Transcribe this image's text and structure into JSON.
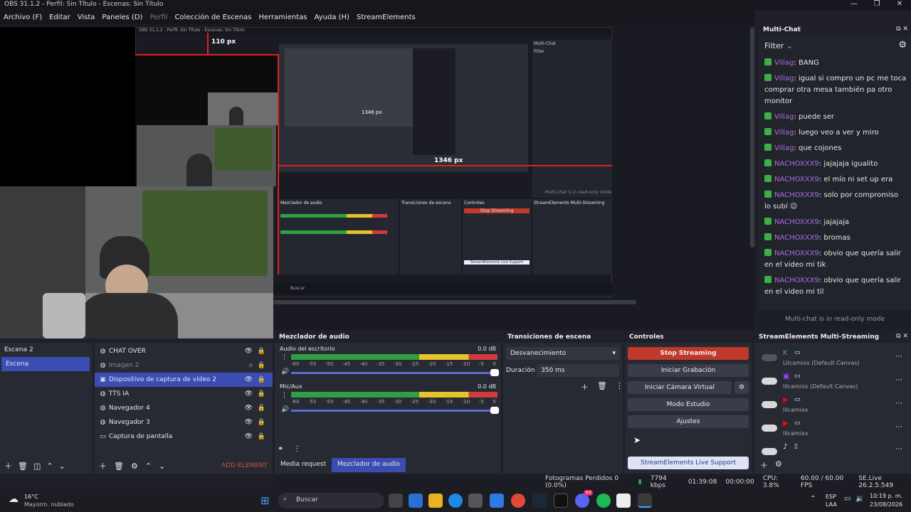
{
  "window": {
    "title": "OBS 31.1.2 - Perfil: Sin Título - Escenas: Sin Título",
    "controls": [
      "—",
      "❐",
      "✕"
    ]
  },
  "menu": [
    {
      "label": "Archivo (F)",
      "enabled": true
    },
    {
      "label": "Editar",
      "enabled": true
    },
    {
      "label": "Vista",
      "enabled": true
    },
    {
      "label": "Paneles (D)",
      "enabled": true
    },
    {
      "label": "Perfil",
      "enabled": false
    },
    {
      "label": "Colección de Escenas",
      "enabled": true
    },
    {
      "label": "Herramientas",
      "enabled": true
    },
    {
      "label": "Ayuda (H)",
      "enabled": true
    },
    {
      "label": "StreamElements",
      "enabled": true
    }
  ],
  "preview": {
    "nested_title": "OBS 31.1.2 - Perfil: Sin Título - Escenas: Sin Título",
    "measure_top": "110 px",
    "measure_right": "1346 px",
    "measure_inner": "1346 px",
    "inner_multichat": "Multi-Chat",
    "inner_filter": "Filter",
    "inner_readonly": "Multi-chat is in read-only mode",
    "inner_audio": "Mezclador de audio",
    "inner_transitions": "Transiciones de escena",
    "inner_controls": "Controles",
    "inner_se": "StreamElements Multi-Streaming",
    "inner_stop": "Stop Streaming",
    "inner_support": "StreamElements Live Support",
    "inner_search": "Buscar"
  },
  "scenes": {
    "items": [
      {
        "label": "Escena 2",
        "selected": false
      },
      {
        "label": "Escena",
        "selected": true
      }
    ]
  },
  "sources": {
    "items": [
      {
        "label": "CHAT OVER",
        "visible": true,
        "selected": false,
        "icon": "globe-icon"
      },
      {
        "label": "Imagen 2",
        "visible": false,
        "selected": false,
        "icon": "image-icon"
      },
      {
        "label": "Dispositivo de captura de vídeo 2",
        "visible": true,
        "selected": true,
        "icon": "camera-icon"
      },
      {
        "label": "TTS IA",
        "visible": true,
        "selected": false,
        "icon": "globe-icon"
      },
      {
        "label": "Navegador 4",
        "visible": true,
        "selected": false,
        "icon": "globe-icon"
      },
      {
        "label": "Navegador 3",
        "visible": true,
        "selected": false,
        "icon": "globe-icon"
      },
      {
        "label": "Captura de pantalla",
        "visible": true,
        "selected": false,
        "icon": "monitor-icon"
      }
    ],
    "add_element": "ADD ELEMENT"
  },
  "audio": {
    "title": "Mezclador de audio",
    "channels": [
      {
        "name": "Audio del escritorio",
        "db": "0.0 dB",
        "level": 0.85
      },
      {
        "name": "Mic/Aux",
        "db": "0.0 dB",
        "level": 0.95
      }
    ],
    "scale": [
      "-60",
      "-55",
      "-50",
      "-45",
      "-40",
      "-35",
      "-30",
      "-25",
      "-20",
      "-15",
      "-10",
      "-5",
      "0"
    ],
    "tabs": [
      "Media request",
      "Mezclador de audio"
    ]
  },
  "transitions": {
    "title": "Transiciones de escena",
    "selected": "Desvanecimiento",
    "duration_label": "Duración",
    "duration_value": "350 ms"
  },
  "controls": {
    "title": "Controles",
    "stop": "Stop Streaming",
    "record": "Iniciar Grabación",
    "virtualcam": "Iniciar Cámara Virtual",
    "studio": "Modo Estudio",
    "settings": "Ajustes",
    "support": "StreamElements Live Support"
  },
  "multichat": {
    "title": "Multi-Chat",
    "filter": "Filter",
    "readonly": "Multi-chat is in read-only mode",
    "messages": [
      {
        "user": "Villag",
        "text": "BANG"
      },
      {
        "user": "Villag",
        "text": "igual si compro un pc me toca comprar otra mesa también pa otro monitor"
      },
      {
        "user": "Villag",
        "text": "puede ser"
      },
      {
        "user": "Villag",
        "text": "luego veo a ver y miro"
      },
      {
        "user": "Villag",
        "text": "que cojones"
      },
      {
        "user": "NACHOXXX9",
        "text": "jajajaja igualito"
      },
      {
        "user": "NACHOXXX9",
        "text": "el mío ni set up era"
      },
      {
        "user": "NACHOXXX9",
        "text": "solo por compromiso lo subí 😉"
      },
      {
        "user": "NACHOXXX9",
        "text": "jajajaja"
      },
      {
        "user": "NACHOXXX9",
        "text": "bromas"
      },
      {
        "user": "NACHOXXX9",
        "text": "obvio que quería salir en el video mi tik"
      },
      {
        "user": "NACHOXXX9",
        "text": "obvio que quería salir en el video mi til"
      }
    ]
  },
  "se_multi": {
    "title": "StreamElements Multi-Streaming",
    "rows": [
      {
        "name": "Lilcamixx (Default Canvas)",
        "platform": "kick",
        "on": false
      },
      {
        "name": "lilcamixx (Default Canvas)",
        "platform": "twitch",
        "on": true
      },
      {
        "name": "lilcamixx",
        "platform": "youtube",
        "on": true
      },
      {
        "name": "lilcamixx",
        "platform": "youtube",
        "on": true
      },
      {
        "name": "",
        "platform": "tiktok",
        "on": true
      }
    ]
  },
  "status": {
    "dropped": "Fotogramas Perdidos 0 (0.0%)",
    "kbps": "7794 kbps",
    "stream_time": "01:39:08",
    "rec_time": "00:00:00",
    "cpu": "CPU: 3.8%",
    "fps": "60.00 / 60.00 FPS",
    "version": "SE.Live 26.2.5.549"
  },
  "taskbar": {
    "weather_temp": "16°C",
    "weather_desc": "Mayorm. nublado",
    "search": "Buscar",
    "lang1": "ESP",
    "lang2": "LAA",
    "time": "10:19 p. m.",
    "date": "23/08/2026",
    "badge": "99"
  },
  "colors": {
    "stop": "#c0392b",
    "accent": "#3b4db3",
    "chat_user": "#b06be0",
    "meter_green": "#2ea043",
    "meter_yellow": "#e5c32b",
    "meter_red": "#d23b3b"
  }
}
